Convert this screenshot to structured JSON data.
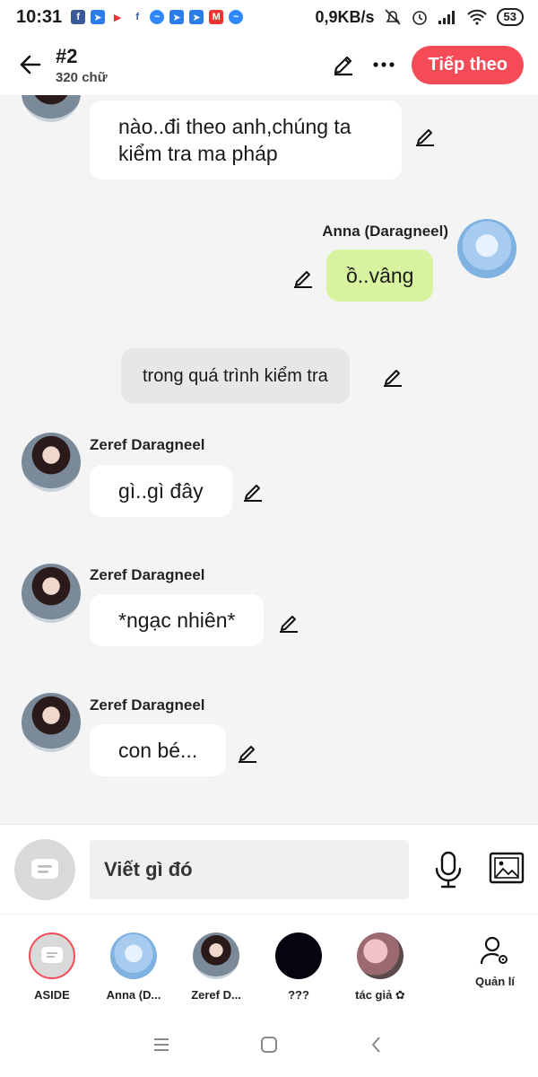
{
  "status_bar": {
    "time": "10:31",
    "net_speed": "0,9KB/s",
    "battery": "53"
  },
  "header": {
    "title": "#2",
    "subtitle": "320 chữ",
    "next_label": "Tiếp theo"
  },
  "messages": [
    {
      "type": "left",
      "sender": "",
      "text": "nào..đi theo anh,chúng ta kiểm tra ma pháp"
    },
    {
      "type": "right",
      "sender": "Anna (Daragneel)",
      "text": "ồ..vâng"
    },
    {
      "type": "aside",
      "text": "trong quá trình kiểm tra"
    },
    {
      "type": "left",
      "sender": "Zeref Daragneel",
      "text": "gì..gì đây"
    },
    {
      "type": "left",
      "sender": "Zeref Daragneel",
      "text": "*ngạc nhiên*"
    },
    {
      "type": "left",
      "sender": "Zeref Daragneel",
      "text": "con bé..."
    }
  ],
  "input": {
    "placeholder": "Viết gì đó"
  },
  "characters": [
    {
      "name": "ASIDE"
    },
    {
      "name": "Anna (D..."
    },
    {
      "name": "Zeref D..."
    },
    {
      "name": "???"
    },
    {
      "name": "tác giả ✿"
    }
  ],
  "manage_label": "Quản lí",
  "colors": {
    "accent": "#f54b57",
    "my_bubble": "#d8f3a0",
    "aside_bubble": "#e7e7e7"
  }
}
